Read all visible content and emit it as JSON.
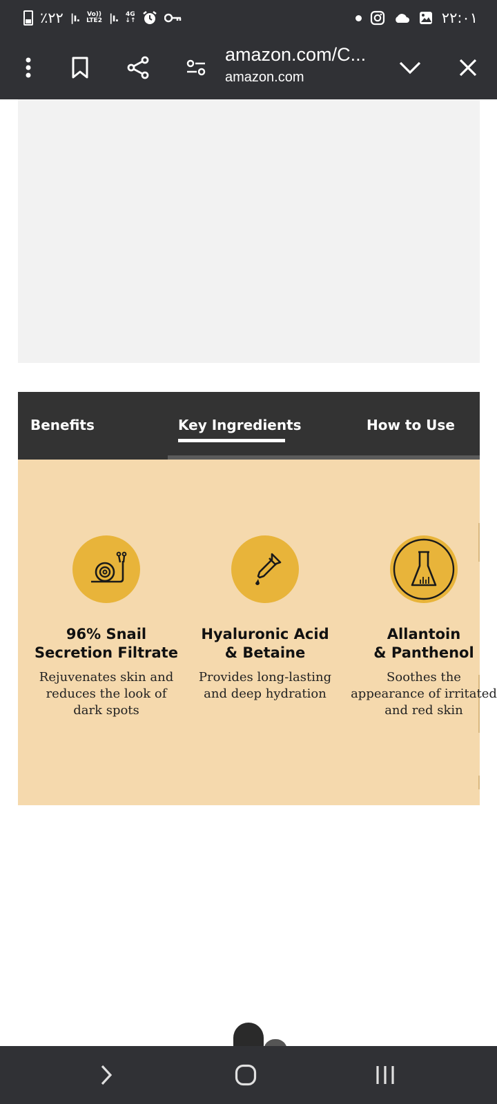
{
  "status_bar": {
    "battery": "٪۲۲",
    "network_4g": "4G",
    "volte": "Vo))",
    "lte": "LTE2",
    "time": "۲۲:۰۱"
  },
  "browser": {
    "url_title": "amazon.com/C...",
    "url_domain": "amazon.com"
  },
  "tabs": [
    {
      "label": "Benefits",
      "active": false
    },
    {
      "label": "Key Ingredients",
      "active": true
    },
    {
      "label": "How to Use",
      "active": false
    }
  ],
  "ingredients": [
    {
      "icon": "snail-icon",
      "title_line1": "96% Snail",
      "title_line2": "Secretion Filtrate",
      "desc": "Rejuvenates skin and reduces the look of dark spots"
    },
    {
      "icon": "dropper-icon",
      "title_line1": "Hyaluronic Acid",
      "title_line2": "& Betaine",
      "desc": "Provides long-lasting and deep hydration"
    },
    {
      "icon": "flask-icon",
      "title_line1": "Allantoin",
      "title_line2": "& Panthenol",
      "desc": "Soothes the appearance of irritated and red skin"
    }
  ],
  "colors": {
    "chrome": "#303135",
    "tab_bar": "#333333",
    "panel": "#f5d9ad",
    "icon_circle": "#e8b43a"
  }
}
